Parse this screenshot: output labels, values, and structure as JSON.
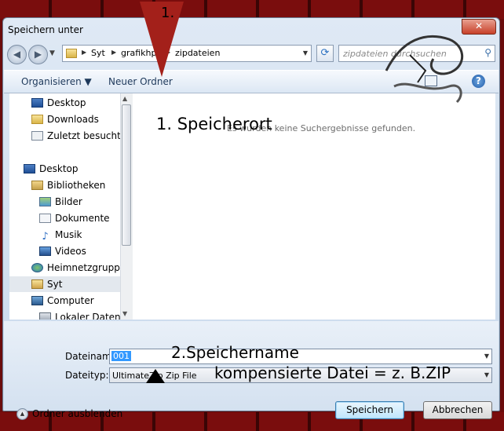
{
  "window": {
    "title": "Speichern unter",
    "close_glyph": "✕"
  },
  "nav": {
    "back_glyph": "◀",
    "forward_glyph": "▶",
    "breadcrumbs": [
      "Syt",
      "grafikhp",
      "zipdateien"
    ],
    "search_placeholder": "zipdateien durchsuchen",
    "refresh_glyph": "⟳",
    "search_glyph": "⚲"
  },
  "toolbar": {
    "organize": "Organisieren ▼",
    "new_folder": "Neuer Ordner",
    "help_glyph": "?"
  },
  "sidebar": {
    "items": [
      {
        "label": "Desktop",
        "icon": "desktop-icon"
      },
      {
        "label": "Downloads",
        "icon": "downloads-folder-icon"
      },
      {
        "label": "Zuletzt besucht",
        "icon": "recent-places-icon"
      },
      {
        "label": "Desktop",
        "icon": "desktop-icon"
      },
      {
        "label": "Bibliotheken",
        "icon": "libraries-icon"
      },
      {
        "label": "Bilder",
        "icon": "pictures-icon"
      },
      {
        "label": "Dokumente",
        "icon": "documents-icon"
      },
      {
        "label": "Musik",
        "icon": "music-icon"
      },
      {
        "label": "Videos",
        "icon": "videos-icon"
      },
      {
        "label": "Heimnetzgruppe",
        "icon": "homegroup-icon"
      },
      {
        "label": "Syt",
        "icon": "user-folder-icon"
      },
      {
        "label": "Computer",
        "icon": "computer-icon"
      },
      {
        "label": "Lokaler Datenträger",
        "icon": "drive-icon"
      }
    ]
  },
  "content": {
    "empty_message": "Es wurden keine Suchergebnisse gefunden."
  },
  "form": {
    "filename_label": "Dateiname:",
    "filename_value": "001",
    "filetype_label": "Dateityp:",
    "filetype_value": "UltimateZip Zip File",
    "hide_folders": "Ordner ausblenden",
    "save": "Speichern",
    "cancel": "Abbrechen"
  },
  "annotations": {
    "arrow_number": "1.",
    "location": "1. Speicherort",
    "name": "2.Speichername",
    "compressed": "kompensierte Datei = z. B.ZIP"
  }
}
